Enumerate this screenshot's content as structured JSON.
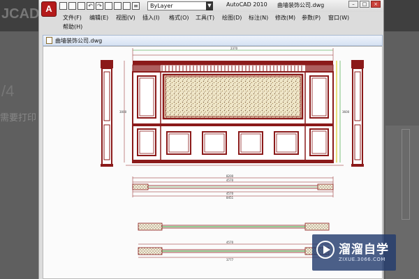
{
  "background": {
    "logo_text": "JCAD",
    "heading": "/4",
    "line_text": "需要打印"
  },
  "window": {
    "app_logo": "A",
    "layer_value": "ByLayer",
    "app_title": "AutoCAD 2010",
    "doc_title": "曲墙装饰公司.dwg",
    "win_min": "–",
    "win_max": "□",
    "win_close": "×"
  },
  "menu": {
    "items": [
      "文件(F)",
      "编辑(E)",
      "视图(V)",
      "插入(I)",
      "格式(O)",
      "工具(T)",
      "绘图(D)",
      "标注(N)",
      "修改(M)",
      "参数(P)",
      "窗口(W)",
      "帮助(H)"
    ]
  },
  "document": {
    "tab_label": "曲墙装饰公司.dwg"
  },
  "drawing": {
    "dims_top_total": "2370",
    "dims_plan_1": "8200",
    "dims_plan_2": "4570",
    "dims_plan_3": "4570",
    "dims_plan_4": "8451",
    "dims_section_1": "4570",
    "dims_section_2": "3777",
    "left_dim_height": "3000",
    "right_dim_height": "3600"
  },
  "colors": {
    "wall_red": "#8b1a1a",
    "wall_dark": "#6e1010",
    "dim_green": "#2a9a2a",
    "dim_yellow": "#d4c400",
    "texture": "#efe6c8"
  },
  "watermark": {
    "name": "溜溜自学",
    "url": "ZIXUE.3066.COM"
  }
}
